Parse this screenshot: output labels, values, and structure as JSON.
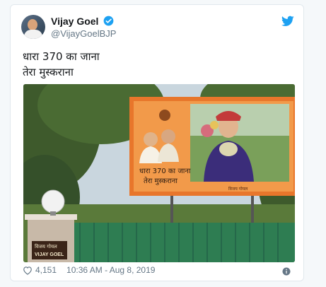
{
  "author": {
    "name": "Vijay Goel",
    "handle": "@VijayGoelBJP"
  },
  "tweet": {
    "line1": "धारा 370 का जाना",
    "line2": "तेरा मुस्कराना"
  },
  "photo": {
    "billboard_text_line1": "धारा 370 का जाना",
    "billboard_text_line2": "तेरा मुस्कराना",
    "billboard_footer": "विजय गोयल",
    "nameplate_line1": "विजय गोयल",
    "nameplate_line2": "VIJAY GOEL"
  },
  "meta": {
    "likes": "4,151",
    "timestamp": "10:36 AM - Aug 8, 2019"
  },
  "colors": {
    "twitter_blue": "#1da1f2",
    "billboard_orange": "#e8762b",
    "text_primary": "#14171a",
    "text_secondary": "#657786"
  },
  "icons": [
    "verified-icon",
    "twitter-bird-icon",
    "heart-icon",
    "info-icon"
  ]
}
